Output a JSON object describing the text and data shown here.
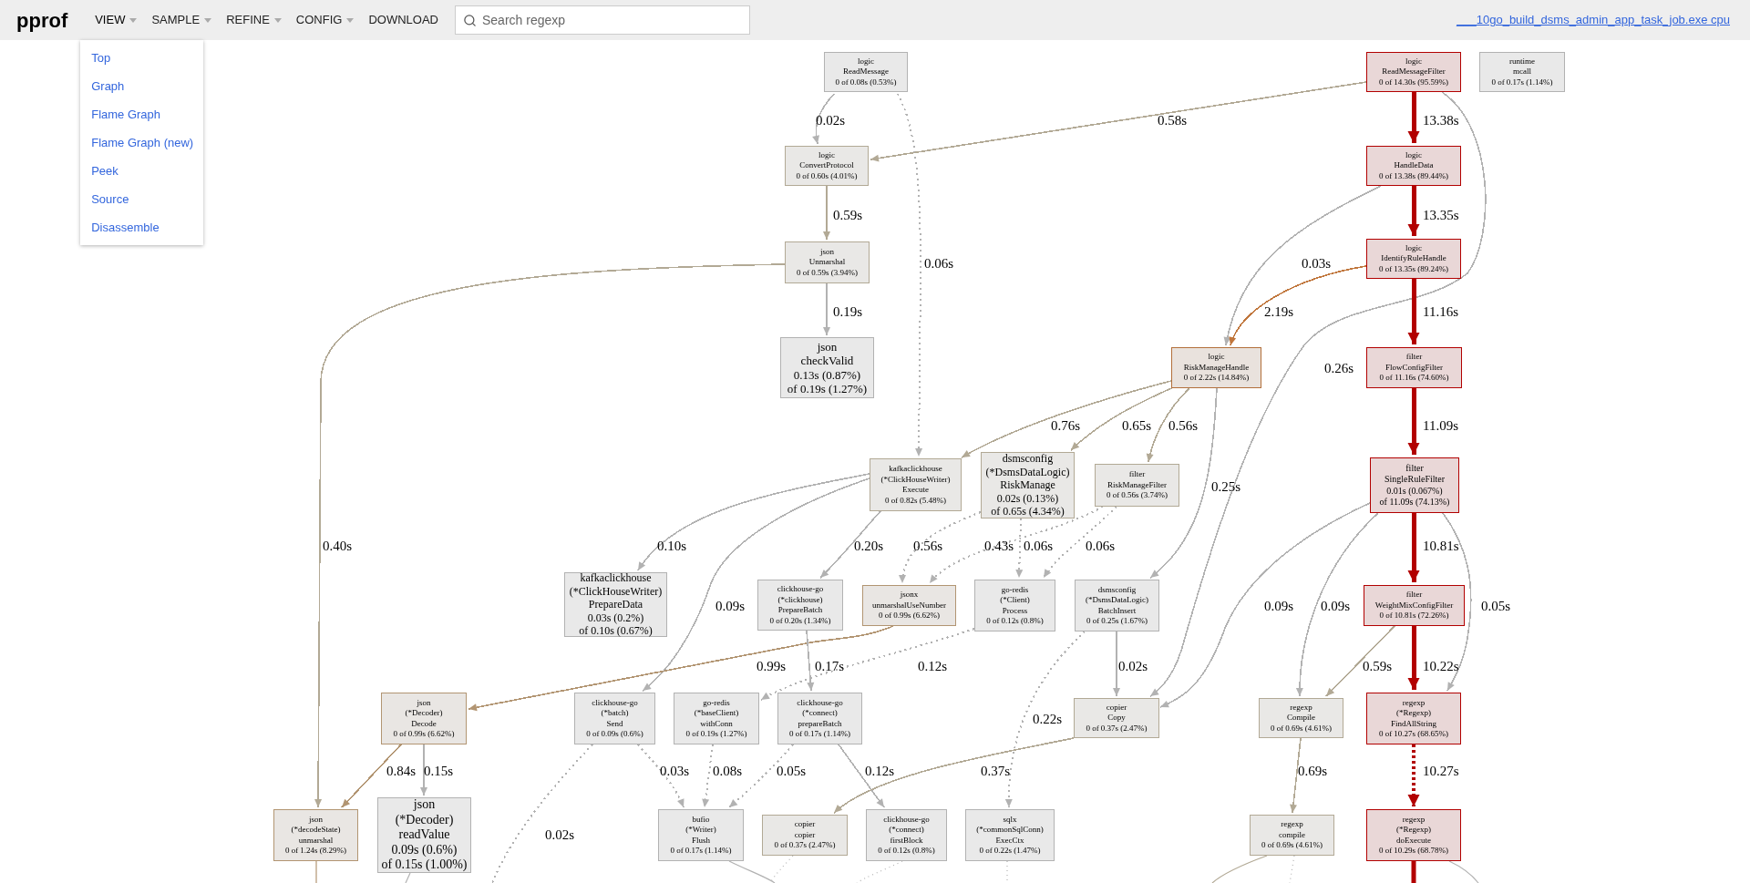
{
  "header": {
    "logo": "pprof",
    "menus": [
      {
        "label": "VIEW",
        "caret": true,
        "expanded": true
      },
      {
        "label": "SAMPLE",
        "caret": true,
        "expanded": false
      },
      {
        "label": "REFINE",
        "caret": true,
        "expanded": false
      },
      {
        "label": "CONFIG",
        "caret": true,
        "expanded": false
      },
      {
        "label": "DOWNLOAD",
        "caret": false,
        "expanded": false
      }
    ],
    "search": {
      "placeholder": "Search regexp"
    },
    "profile_link": "___10go_build_dsms_admin_app_task_job.exe cpu"
  },
  "view_menu": {
    "items": [
      "Top",
      "Graph",
      "Flame Graph",
      "Flame Graph (new)",
      "Peek",
      "Source",
      "Disassemble"
    ]
  },
  "graph": {
    "nodes": [
      {
        "lines": [
          "logic",
          "ReadMessage",
          "0 of 0.08s (0.53%)"
        ],
        "color": "#b2b2b2"
      },
      {
        "lines": [
          "logic",
          "ReadMessageFilter",
          "0 of 14.30s (95.59%)"
        ],
        "color": "#b20000"
      },
      {
        "lines": [
          "runtime",
          "mcall",
          "0 of 0.17s (1.14%)"
        ],
        "color": "#b2b2b2"
      },
      {
        "lines": [
          "logic",
          "ConvertProtocol",
          "0 of 0.60s (4.01%)"
        ],
        "color": "#b2a995"
      },
      {
        "lines": [
          "logic",
          "HandleData",
          "0 of 13.38s (89.44%)"
        ],
        "color": "#b20000"
      },
      {
        "lines": [
          "json",
          "Unmarshal",
          "0 of 0.59s (3.94%)"
        ],
        "color": "#b2a995"
      },
      {
        "lines": [
          "logic",
          "IdentifyRuleHandle",
          "0 of 13.35s (89.24%)"
        ],
        "color": "#b20000"
      },
      {
        "lines": [
          "json",
          "checkValid",
          "0.13s (0.87%)",
          "of 0.19s (1.27%)"
        ],
        "color": "#b2b2b2"
      },
      {
        "lines": [
          "logic",
          "RiskManageHandle",
          "0 of 2.22s (14.84%)"
        ],
        "color": "#b26f3a"
      },
      {
        "lines": [
          "filter",
          "FlowConfigFilter",
          "0 of 11.16s (74.60%)"
        ],
        "color": "#b20000"
      },
      {
        "lines": [
          "kafkaclickhouse",
          "(*ClickHouseWriter)",
          "Execute",
          "0 of 0.82s (5.48%)"
        ],
        "color": "#b2a995"
      },
      {
        "lines": [
          "dsmsconfig",
          "(*DsmsDataLogic)",
          "RiskManage",
          "0.02s (0.13%)",
          "of 0.65s (4.34%)"
        ],
        "color": "#b2a995"
      },
      {
        "lines": [
          "filter",
          "RiskManageFilter",
          "0 of 0.56s (3.74%)"
        ],
        "color": "#b2a995"
      },
      {
        "lines": [
          "filter",
          "SingleRuleFilter",
          "0.01s (0.067%)",
          "of 11.09s (74.13%)"
        ],
        "color": "#b20000"
      },
      {
        "lines": [
          "kafkaclickhouse",
          "(*ClickHouseWriter)",
          "PrepareData",
          "0.03s (0.2%)",
          "of 0.10s (0.67%)"
        ],
        "color": "#b2b2b2"
      },
      {
        "lines": [
          "clickhouse-go",
          "(*clickhouse)",
          "PrepareBatch",
          "0 of 0.20s (1.34%)"
        ],
        "color": "#b2b2b2"
      },
      {
        "lines": [
          "jsonx",
          "unmarshalUseNumber",
          "0 of 0.99s (6.62%)"
        ],
        "color": "#b29572"
      },
      {
        "lines": [
          "go-redis",
          "(*Client)",
          "Process",
          "0 of 0.12s (0.8%)"
        ],
        "color": "#b2b2b2"
      },
      {
        "lines": [
          "dsmsconfig",
          "(*DsmsDataLogic)",
          "BatchInsert",
          "0 of 0.25s (1.67%)"
        ],
        "color": "#b2b2b2"
      },
      {
        "lines": [
          "filter",
          "WeightMixConfigFilter",
          "0 of 10.81s (72.26%)"
        ],
        "color": "#b20000"
      },
      {
        "lines": [
          "json",
          "(*Decoder)",
          "Decode",
          "0 of 0.99s (6.62%)"
        ],
        "color": "#b29572"
      },
      {
        "lines": [
          "clickhouse-go",
          "(*batch)",
          "Send",
          "0 of 0.09s (0.6%)"
        ],
        "color": "#b2b2b2"
      },
      {
        "lines": [
          "go-redis",
          "(*baseClient)",
          "withConn",
          "0 of 0.19s (1.27%)"
        ],
        "color": "#b2b2b2"
      },
      {
        "lines": [
          "clickhouse-go",
          "(*connect)",
          "prepareBatch",
          "0 of 0.17s (1.14%)"
        ],
        "color": "#b2b2b2"
      },
      {
        "lines": [
          "copier",
          "Copy",
          "0 of 0.37s (2.47%)"
        ],
        "color": "#b2a995"
      },
      {
        "lines": [
          "regexp",
          "Compile",
          "0 of 0.69s (4.61%)"
        ],
        "color": "#b2a995"
      },
      {
        "lines": [
          "regexp",
          "(*Regexp)",
          "FindAllString",
          "0 of 10.27s (68.65%)"
        ],
        "color": "#b20000"
      },
      {
        "lines": [
          "json",
          "(*decodeState)",
          "unmarshal",
          "0 of 1.24s (8.29%)"
        ],
        "color": "#b29572"
      },
      {
        "lines": [
          "json",
          "(*Decoder)",
          "readValue",
          "0.09s (0.6%)",
          "of 0.15s (1.00%)"
        ],
        "color": "#b2b2b2"
      },
      {
        "lines": [
          "bufio",
          "(*Writer)",
          "Flush",
          "0 of 0.17s (1.14%)"
        ],
        "color": "#b2b2b2"
      },
      {
        "lines": [
          "copier",
          "copier",
          "0 of 0.37s (2.47%)"
        ],
        "color": "#b2a995"
      },
      {
        "lines": [
          "clickhouse-go",
          "(*connect)",
          "firstBlock",
          "0 of 0.12s (0.8%)"
        ],
        "color": "#b2b2b2"
      },
      {
        "lines": [
          "sqlx",
          "(*commonSqlConn)",
          "ExecCtx",
          "0 of 0.22s (1.47%)"
        ],
        "color": "#b2b2b2"
      },
      {
        "lines": [
          "regexp",
          "compile",
          "0 of 0.69s (4.61%)"
        ],
        "color": "#b2a995"
      },
      {
        "lines": [
          "regexp",
          "(*Regexp)",
          "doExecute",
          "0 of 10.29s (68.78%)"
        ],
        "color": "#b20000"
      }
    ],
    "edges": [
      {
        "label": "0.02s",
        "kind": "solid",
        "color": "#b2b2b2"
      },
      {
        "label": "0.06s",
        "kind": "dotted",
        "color": "#b2b2b2"
      },
      {
        "label": "0.58s",
        "kind": "solid",
        "color": "#b2a995"
      },
      {
        "label": "13.38s",
        "kind": "heavy",
        "color": "#b20000"
      },
      {
        "label": "13.35s",
        "kind": "heavy",
        "color": "#b20000"
      },
      {
        "label": "0.26s",
        "kind": "solid",
        "color": "#b2b2b2"
      },
      {
        "label": "0.03s",
        "kind": "solid",
        "color": "#b2b2b2"
      },
      {
        "label": "2.19s",
        "kind": "solid",
        "color": "#c0763c"
      },
      {
        "label": "11.16s",
        "kind": "heavy",
        "color": "#b20000"
      },
      {
        "label": "11.09s",
        "kind": "heavy",
        "color": "#b20000"
      },
      {
        "label": "0.59s",
        "kind": "solid",
        "color": "#b2a995"
      },
      {
        "label": "0.19s",
        "kind": "solid",
        "color": "#b2b2b2"
      },
      {
        "label": "0.40s",
        "kind": "solid",
        "color": "#b2a995"
      },
      {
        "label": "0.76s",
        "kind": "solid",
        "color": "#b2a995"
      },
      {
        "label": "0.65s",
        "kind": "solid",
        "color": "#b2a995"
      },
      {
        "label": "0.56s",
        "kind": "solid",
        "color": "#b2a995"
      },
      {
        "label": "0.25s",
        "kind": "solid",
        "color": "#b2b2b2"
      },
      {
        "label": "10.81s",
        "kind": "heavy",
        "color": "#b20000"
      },
      {
        "label": "0.09s",
        "kind": "solid",
        "color": "#b2b2b2"
      },
      {
        "label": "0.09s",
        "kind": "solid",
        "color": "#b2b2b2"
      },
      {
        "label": "0.05s",
        "kind": "solid",
        "color": "#b2b2b2"
      },
      {
        "label": "0.59s",
        "kind": "solid",
        "color": "#b2a995"
      },
      {
        "label": "10.22s",
        "kind": "heavy",
        "color": "#b20000"
      },
      {
        "label": "10.27s",
        "kind": "dashed",
        "color": "#b20000"
      },
      {
        "label": "0.10s",
        "kind": "solid",
        "color": "#b2b2b2"
      },
      {
        "label": "0.09s",
        "kind": "solid",
        "color": "#b2b2b2"
      },
      {
        "label": "0.20s",
        "kind": "solid",
        "color": "#b2b2b2"
      },
      {
        "label": "0.56s",
        "kind": "dotted",
        "color": "#b2b2b2"
      },
      {
        "label": "0.43s",
        "kind": "dotted",
        "color": "#b2b2b2"
      },
      {
        "label": "0.06s",
        "kind": "dotted",
        "color": "#b2b2b2"
      },
      {
        "label": "0.06s",
        "kind": "dotted",
        "color": "#b2b2b2"
      },
      {
        "label": "0.99s",
        "kind": "solid",
        "color": "#b29572"
      },
      {
        "label": "0.17s",
        "kind": "solid",
        "color": "#b2b2b2"
      },
      {
        "label": "0.12s",
        "kind": "dotted",
        "color": "#b2b2b2"
      },
      {
        "label": "0.02s",
        "kind": "solid",
        "color": "#b2b2b2"
      },
      {
        "label": "0.84s",
        "kind": "solid",
        "color": "#b29572"
      },
      {
        "label": "0.15s",
        "kind": "solid",
        "color": "#b2b2b2"
      },
      {
        "label": "0.03s",
        "kind": "dotted",
        "color": "#b2b2b2"
      },
      {
        "label": "0.08s",
        "kind": "dotted",
        "color": "#b2b2b2"
      },
      {
        "label": "0.05s",
        "kind": "dotted",
        "color": "#b2b2b2"
      },
      {
        "label": "0.12s",
        "kind": "solid",
        "color": "#b2b2b2"
      },
      {
        "label": "0.37s",
        "kind": "solid",
        "color": "#b2a995"
      },
      {
        "label": "0.22s",
        "kind": "dotted",
        "color": "#b2b2b2"
      },
      {
        "label": "0.69s",
        "kind": "solid",
        "color": "#b2a995"
      },
      {
        "label": "0.02s",
        "kind": "dotted",
        "color": "#b2b2b2"
      }
    ]
  }
}
